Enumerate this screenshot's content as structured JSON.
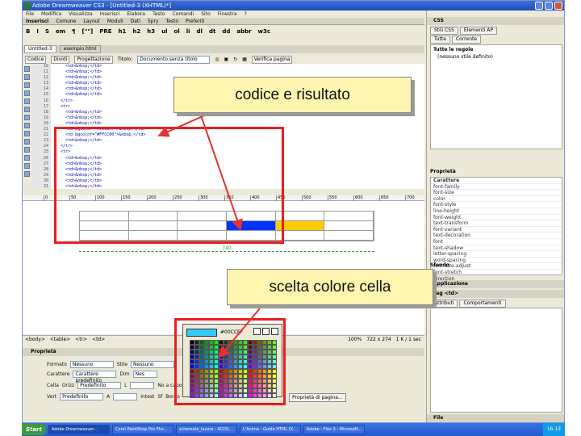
{
  "app": {
    "title": "Adobe Dreamweaver CS3 - [Untitled-3 (XHTML)*]",
    "menu": [
      "File",
      "Modifica",
      "Visualizza",
      "Inserisci",
      "Elabora",
      "Testo",
      "Comandi",
      "Sito",
      "Finestra",
      "?"
    ]
  },
  "insert_bar": {
    "lead": "Inserisci",
    "tabs": [
      "Comune",
      "Layout",
      "Moduli",
      "Dati",
      "Spry",
      "Testo",
      "Preferiti"
    ]
  },
  "format_tools": [
    "B",
    "I",
    "S",
    "em",
    "¶",
    "[\"\"]",
    "PRE",
    "h1",
    "h2",
    "h3",
    "ul",
    "ol",
    "li",
    "dl",
    "dt",
    "dd",
    "abbr",
    "w3c"
  ],
  "document": {
    "tabs": [
      "Untitled-3",
      "esempio.html"
    ],
    "view_buttons": [
      "Codice",
      "Dividi",
      "Progettazione"
    ],
    "title_label": "Titolo:",
    "title_value": "Documento senza titolo",
    "validate_button": "Verifica pagina"
  },
  "code": {
    "lines": [
      {
        "n": "10",
        "t": "    <td>&nbsp;</td>"
      },
      {
        "n": "11",
        "t": "    <td>&nbsp;</td>"
      },
      {
        "n": "12",
        "t": "    <td>&nbsp;</td>"
      },
      {
        "n": "13",
        "t": "    <td>&nbsp;</td>"
      },
      {
        "n": "14",
        "t": "    <td>&nbsp;</td>"
      },
      {
        "n": "15",
        "t": "    <td>&nbsp;</td>"
      },
      {
        "n": "16",
        "t": "  </tr>"
      },
      {
        "n": "17",
        "t": "  <tr>"
      },
      {
        "n": "18",
        "t": "    <td>&nbsp;</td>"
      },
      {
        "n": "19",
        "t": "    <td>&nbsp;</td>"
      },
      {
        "n": "20",
        "t": "    <td>&nbsp;</td>"
      },
      {
        "n": "21",
        "t": "    <td bgcolor=\"#0033FF\">&nbsp;</td>"
      },
      {
        "n": "22",
        "t": "    <td bgcolor=\"#FFCC00\">&nbsp;</td>"
      },
      {
        "n": "23",
        "t": "    <td>&nbsp;</td>"
      },
      {
        "n": "24",
        "t": "  </tr>"
      },
      {
        "n": "25",
        "t": "  <tr>"
      },
      {
        "n": "26",
        "t": "    <td>&nbsp;</td>"
      },
      {
        "n": "27",
        "t": "    <td>&nbsp;</td>"
      },
      {
        "n": "28",
        "t": "    <td>&nbsp;</td>"
      },
      {
        "n": "29",
        "t": "    <td>&nbsp;</td>"
      },
      {
        "n": "30",
        "t": "    <td>&nbsp;</td>"
      },
      {
        "n": "31",
        "t": "    <td>&nbsp;</td>"
      }
    ]
  },
  "ruler_labels": [
    "0",
    "50",
    "100",
    "150",
    "200",
    "250",
    "300",
    "350",
    "400",
    "450",
    "500",
    "550",
    "600",
    "650",
    "700"
  ],
  "design": {
    "cell_colors": {
      "blue": "#0033FF",
      "yellow": "#FFCC00"
    },
    "width_label": "740"
  },
  "status_bar": {
    "tags": [
      "<body>",
      "<table>",
      "<tr>",
      "<td>"
    ],
    "zoom": "100%",
    "size": "722 x 274",
    "weight": "1 K / 1 sec"
  },
  "properties": {
    "header": "Proprietà",
    "format_label": "Formato",
    "format_value": "Nessuno",
    "style_label": "Stile",
    "style_value": "Nessuno",
    "font_label": "Carattere",
    "font_value": "Carattere predefinito",
    "size_label": "Dim",
    "size_value": "Nes",
    "cell_label": "Cella",
    "horz_label": "Orizz",
    "horz_value": "Predefinito",
    "vert_label": "Vert",
    "vert_value": "Predefinito",
    "w_label": "L",
    "h_label": "A",
    "nowrap_label": "No a capo",
    "header_label": "Intest",
    "bg_label": "Sf",
    "border_label": "Bordo",
    "page_props": "Proprietà di pagina..."
  },
  "right_panel": {
    "css_header": "CSS",
    "css_tabs": [
      "Stili CSS",
      "Elementi AP"
    ],
    "mode_tabs": [
      "Tutte",
      "Corrente"
    ],
    "all_rules_label": "Tutte le regole",
    "no_style": "(nessuno stile definito)",
    "props_label": "Proprietà",
    "prop_list": [
      "Carattere",
      "font-family",
      "font-size",
      "color",
      "font-style",
      "line-height",
      "font-weight",
      "text-transform",
      "font-variant",
      "text-decoration",
      "font",
      "text-shadow",
      "letter-spacing",
      "word-spacing",
      "font-size-adjust",
      "font-stretch",
      "direction",
      "unicode-bidi"
    ],
    "bg_group": "Sfondo",
    "app_header": "Applicazione",
    "tag_header": "Tag <td>",
    "tag_tabs": [
      "Attributi",
      "Comportamenti"
    ],
    "files_header": "File"
  },
  "picker": {
    "hex": "#00CCFF",
    "selected_color": "#33ccff"
  },
  "annotations": {
    "top": "codice  e risultato",
    "bottom": "scelta colore cella"
  },
  "taskbar": {
    "start": "Start",
    "tasks": [
      "Adobe Dreamweaver...",
      "Corel PaintShop Pro Pho...",
      "schemato_lavoro - ACDS...",
      "L'Anima - Guida HTML (X...",
      "Adobe - Flex 3 - Microsoft..."
    ],
    "clock": "16.13"
  }
}
